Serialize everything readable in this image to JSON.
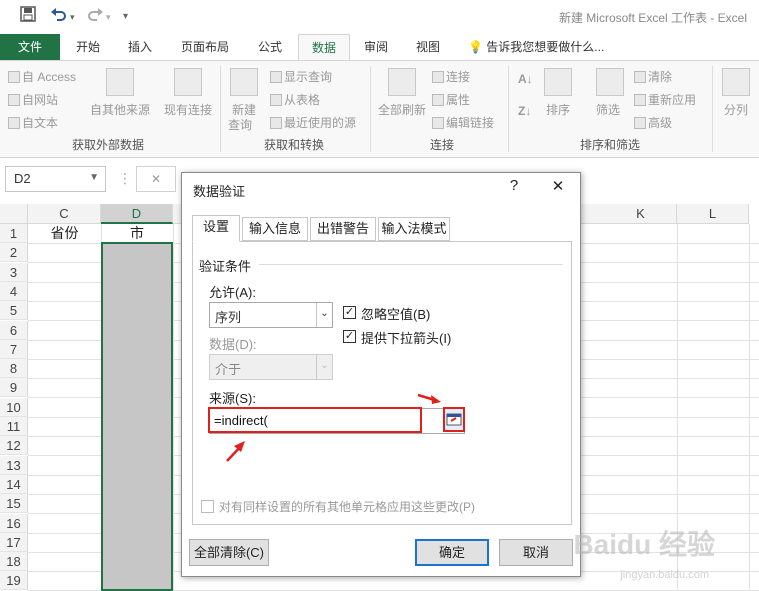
{
  "app": {
    "title": "新建 Microsoft Excel 工作表 - Excel"
  },
  "quick_access": {
    "save_icon": "save-icon",
    "undo_icon": "undo-icon",
    "redo_icon": "redo-icon",
    "customize_icon": "customize-icon"
  },
  "ribbon_tabs": [
    "文件",
    "开始",
    "插入",
    "页面布局",
    "公式",
    "数据",
    "审阅",
    "视图"
  ],
  "tell_me": "告诉我您想要做什么...",
  "ribbon": {
    "groups": [
      "获取外部数据",
      "获取和转换",
      "连接",
      "排序和筛选"
    ],
    "access": "自 Access",
    "web": "自网站",
    "text": "自文本",
    "other_sources": "自其他来源",
    "existing": "现有连接",
    "new_query_1": "新建",
    "new_query_2": "查询",
    "show_query": "显示查询",
    "from_table": "从表格",
    "recent": "最近使用的源",
    "refresh_all": "全部刷新",
    "connections": "连接",
    "properties": "属性",
    "edit_links": "编辑链接",
    "sort": "排序",
    "filter": "筛选",
    "clear": "清除",
    "reapply": "重新应用",
    "advanced": "高级",
    "split": "分列"
  },
  "formula_bar": {
    "namebox": "D2",
    "cancel": "✕"
  },
  "sheet": {
    "columns": [
      "C",
      "D",
      "K",
      "L"
    ],
    "rows": [
      "1",
      "2",
      "3",
      "4",
      "5",
      "6",
      "7",
      "8",
      "9",
      "10",
      "11",
      "12",
      "13",
      "14",
      "15",
      "16",
      "17",
      "18",
      "19"
    ],
    "c1": "省份",
    "d1": "市"
  },
  "dialog": {
    "title": "数据验证",
    "help": "?",
    "close": "✕",
    "tabs": [
      "设置",
      "输入信息",
      "出错警告",
      "输入法模式"
    ],
    "criteria_label": "验证条件",
    "allow_label": "允许(A):",
    "allow_value": "序列",
    "data_label": "数据(D):",
    "data_value": "介于",
    "ignore_blank": "忽略空值(B)",
    "in_cell_dropdown": "提供下拉箭头(I)",
    "source_label": "来源(S):",
    "source_value": "=indirect(",
    "apply_all": "对有同样设置的所有其他单元格应用这些更改(P)",
    "clear_all": "全部清除(C)",
    "ok": "确定",
    "cancel": "取消"
  },
  "watermark": {
    "main": "Baidu 经验",
    "sub": "jingyan.baidu.com"
  },
  "colors": {
    "excel_green": "#217346",
    "annotation_red": "#e0201d",
    "ok_border": "#1d73cc"
  }
}
